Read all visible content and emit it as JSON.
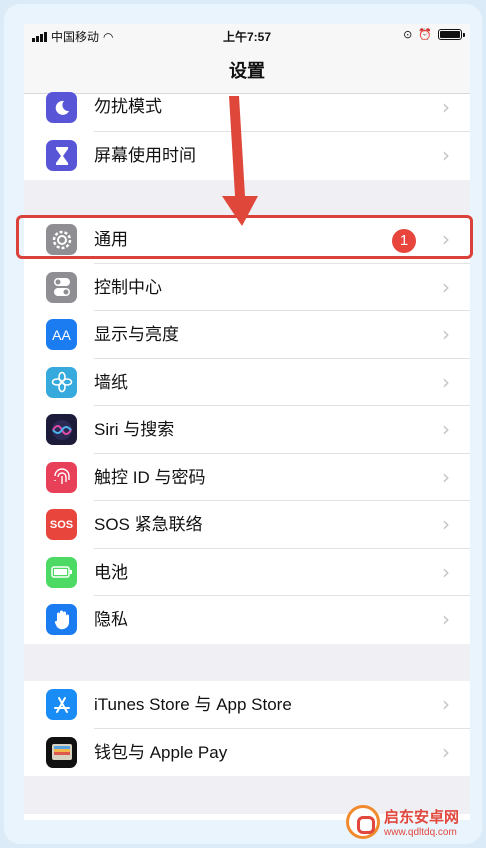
{
  "statusbar": {
    "carrier": "中国移动",
    "time": "上午7:57"
  },
  "navbar": {
    "title": "设置"
  },
  "groups": [
    {
      "items": [
        {
          "label": "勿扰模式",
          "icon": "moon-icon",
          "color": "#5856d6"
        },
        {
          "label": "屏幕使用时间",
          "icon": "hourglass-icon",
          "color": "#5856d6"
        }
      ]
    },
    {
      "items": [
        {
          "label": "通用",
          "icon": "gear-icon",
          "color": "#8e8e93",
          "badge": "1"
        },
        {
          "label": "控制中心",
          "icon": "toggle-icon",
          "color": "#8e8e93"
        },
        {
          "label": "显示与亮度",
          "icon": "text-size-icon",
          "color": "#1a7cf0",
          "glyph": "AA"
        },
        {
          "label": "墙纸",
          "icon": "flower-icon",
          "color": "#36aadc"
        },
        {
          "label": "Siri 与搜索",
          "icon": "siri-icon",
          "color": "#1c1c3a"
        },
        {
          "label": "触控 ID 与密码",
          "icon": "fingerprint-icon",
          "color": "#e9405a"
        },
        {
          "label": "SOS 紧急联络",
          "icon": "sos-icon",
          "color": "#e8453c",
          "glyph": "SOS"
        },
        {
          "label": "电池",
          "icon": "battery-icon",
          "color": "#4cd964"
        },
        {
          "label": "隐私",
          "icon": "hand-icon",
          "color": "#1a7cf0"
        }
      ]
    },
    {
      "items": [
        {
          "label": "iTunes Store 与 App Store",
          "icon": "app-store-icon",
          "color": "#1a8cf5"
        },
        {
          "label": "钱包与 Apple Pay",
          "icon": "wallet-icon",
          "color": "#111111"
        }
      ]
    }
  ],
  "watermark": {
    "cn": "启东安卓网",
    "en": "www.qdltdq.com"
  },
  "colors": {
    "highlight": "#d9413a",
    "arrow": "#e0473b",
    "badge": "#e8453c"
  }
}
